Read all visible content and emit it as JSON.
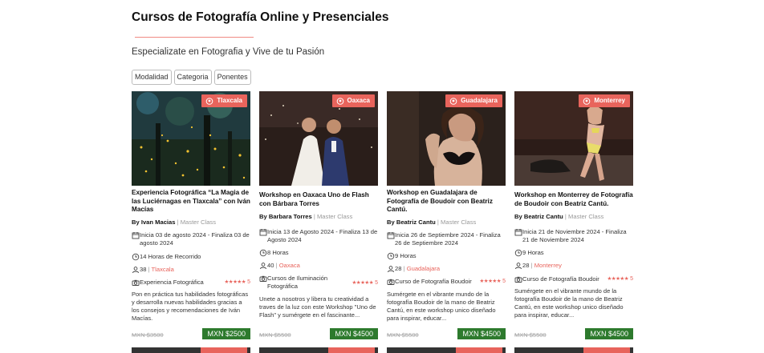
{
  "page": {
    "title": "Cursos de Fotografía Online y Presenciales",
    "subtitle": "Especializate en Fotografia y Vive de tu Pasión"
  },
  "filters": [
    {
      "label": "Modalidad"
    },
    {
      "label": "Categoria"
    },
    {
      "label": "Ponentes"
    }
  ],
  "colors": {
    "accent": "#e8645c",
    "price_button": "#2d7a2d"
  },
  "cards": [
    {
      "location_badge": "Tlaxcala",
      "title": "Experiencia Fotográfica “La Magia de las Luciérnagas en Tlaxcala” con Iván Macías",
      "by": "By",
      "author": "Ivan Macias",
      "role": "Master Class",
      "dates": "Inicia 03 de agosto 2024 - Finaliza 03 de agosto 2024",
      "duration": "14 Horas de Recorrido",
      "seats": "38",
      "location": "Tlaxcala",
      "category": "Experiencia Fotográfica",
      "rating": "5",
      "description": "Pon en práctica tus habilidades fotográficas y desarrolla nuevas habilidades gracias a los consejos y recomendaciones de Iván Macías.",
      "price_old": "MXN $3500",
      "price": "MXN $2500",
      "image_icon": "fireflies-forest-photo"
    },
    {
      "location_badge": "Oaxaca",
      "title": "Workshop en Oaxaca Uno de Flash con Bárbara Torres",
      "by": "By",
      "author": "Barbara Torres",
      "role": "Master Class",
      "dates": "Inicia 13 de Agosto 2024 - Finaliza 13 de Agosto 2024",
      "duration": "8 Horas",
      "seats": "40",
      "location": "Oaxaca",
      "category": "Cursos de Iluminación Fotográfica",
      "rating": "5",
      "description": "Unete a nosotros y libera tu creatividad a traves de la luz con este Workshop \"Uno de Flash\" y sumérgete en el fascinante...",
      "price_old": "MXN $5500",
      "price": "MXN $4500",
      "image_icon": "wedding-couple-photo"
    },
    {
      "location_badge": "Guadalajara",
      "title": "Workshop en Guadalajara de Fotografía de Boudoir con Beatriz Cantú.",
      "by": "By",
      "author": "Beatriz Cantu",
      "role": "Master Class",
      "dates": "Inicia 26 de Septiembre 2024 - Finaliza 26 de Septiembre 2024",
      "duration": "9 Horas",
      "seats": "28",
      "location": "Guadalajara",
      "category": "Curso de Fotografía Boudoir",
      "rating": "5",
      "description": "Sumérgete en el vibrante mundo de la fotografía Boudoir de la mano de Beatriz Cantú, en este workshop unico diseñado para inspirar, educar...",
      "price_old": "MXN $5500",
      "price": "MXN $4500",
      "image_icon": "boudoir-portrait-photo"
    },
    {
      "location_badge": "Monterrey",
      "title": "Workshop en Monterrey de Fotografía de Boudoir con Beatriz Cantú.",
      "by": "By",
      "author": "Beatriz Cantu",
      "role": "Master Class",
      "dates": "Inicia 21 de Noviembre 2024 - Finaliza 21 de Noviembre 2024",
      "duration": "9 Horas",
      "seats": "28",
      "location": "Monterrey",
      "category": "Curso de Fotografía Boudoir",
      "rating": "5",
      "description": "Sumérgete en el vibrante mundo de la fotografía Boudoir de la mano de Beatriz Cantú, en este workshop unico diseñado para inspirar, educar...",
      "price_old": "MXN $5500",
      "price": "MXN $4500",
      "image_icon": "boudoir-bedroom-photo"
    }
  ]
}
